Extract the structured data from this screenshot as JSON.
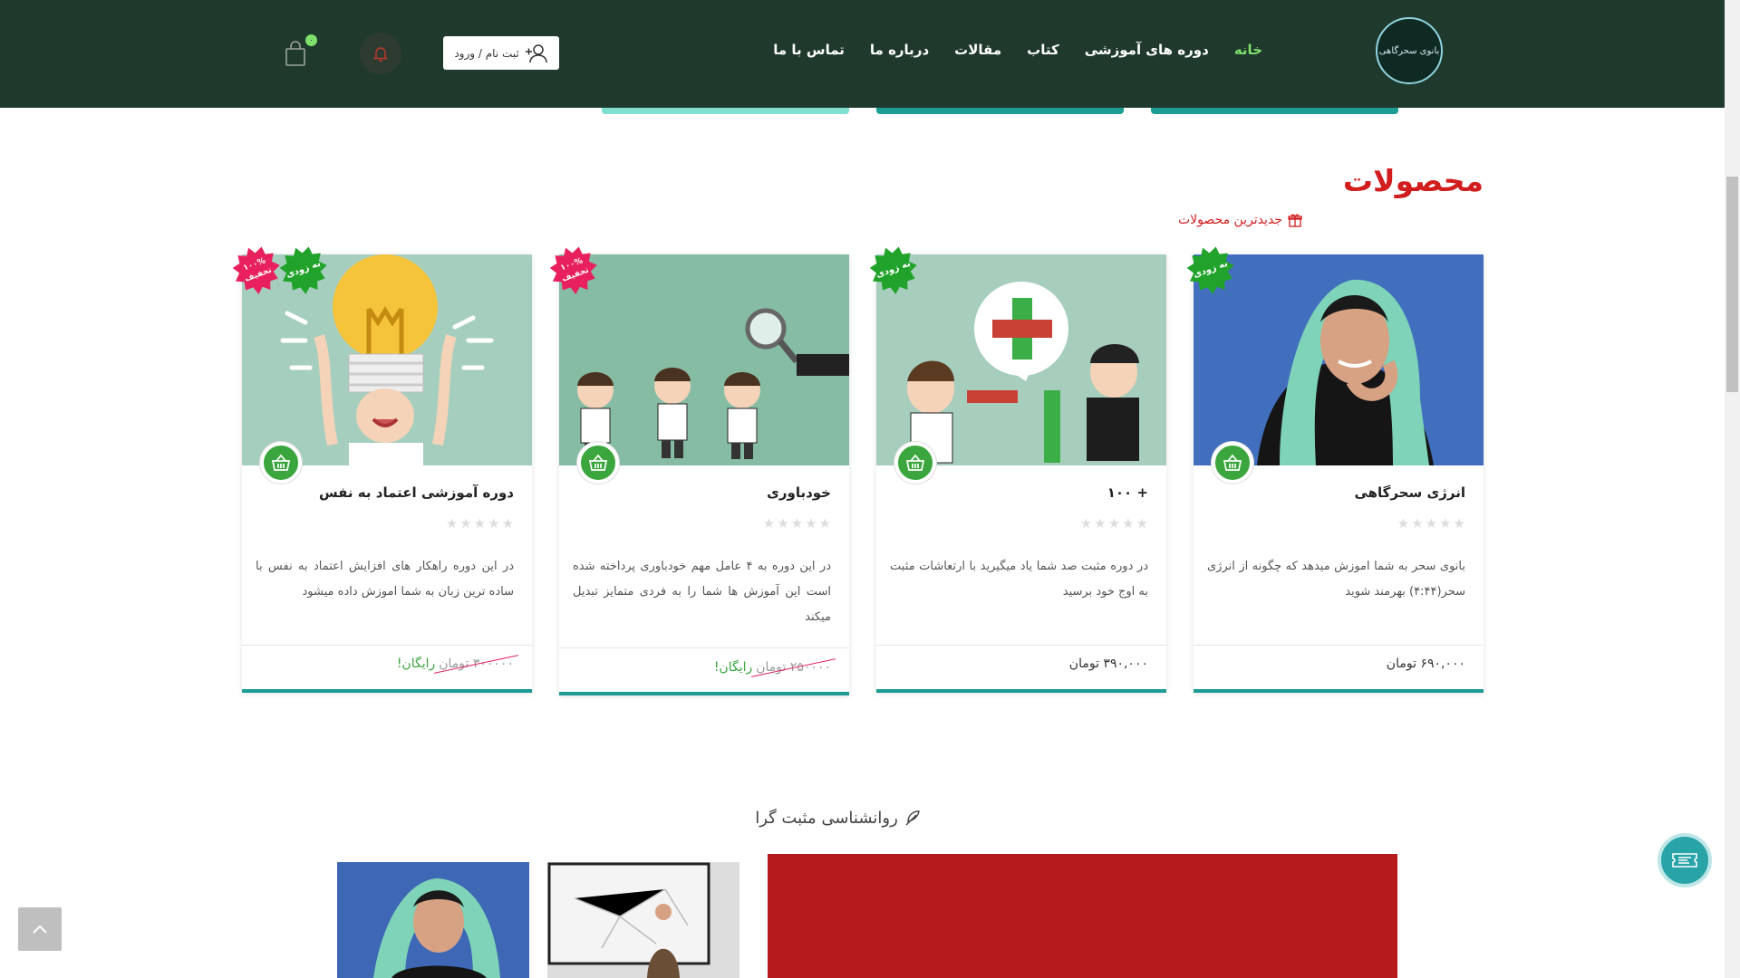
{
  "header": {
    "logo_text": "بانوی سحرگاهی",
    "nav": [
      {
        "label": "خانه",
        "active": true
      },
      {
        "label": "دوره های آموزشی",
        "active": false
      },
      {
        "label": "کتاب",
        "active": false
      },
      {
        "label": "مقالات",
        "active": false
      },
      {
        "label": "درباره ما",
        "active": false
      },
      {
        "label": "تماس با ما",
        "active": false
      }
    ],
    "login_label": "ثبت نام / ورود",
    "cart_count": "۰"
  },
  "products_section": {
    "title": "محصولات",
    "subtitle": "جدیدترین محصولات"
  },
  "products": [
    {
      "title": "انرژی سحرگاهی",
      "description": "بانوی سحر به شما اموزش میدهد که چگونه از انرژی سحر(۴:۴۴) بهرمند شوید",
      "price": "۶۹۰,۰۰۰ تومان",
      "old_price": "",
      "free_label": "",
      "new_badge": "به زودی",
      "discount_badge": ""
    },
    {
      "title": "+ ۱۰۰",
      "description": "در دوره مثبت صد شما یاد میگیرید با ارتعاشات مثبت به اوج خود برسید",
      "price": "۳۹۰,۰۰۰ تومان",
      "old_price": "",
      "free_label": "",
      "new_badge": "به زودی",
      "discount_badge": ""
    },
    {
      "title": "خودباوری",
      "description": "در این دوره به ۴ عامل مهم خودباوری پرداخته شده است این آموزش ها شما را به فردی متمایز تبدیل میکند",
      "price": "",
      "old_price": "۲۵۰۰۰۰ تومان",
      "free_label": "رایگان!",
      "new_badge": "",
      "discount_badge": "۱۰۰% تخفیف"
    },
    {
      "title": "دوره آموزشی اعتماد به نفس",
      "description": "در این دوره راهکار های افزایش اعتماد به نفس با ساده ترین زبان به شما اموزش داده میشود",
      "price": "",
      "old_price": "۳۰۰۰۰۰ تومان",
      "free_label": "رایگان!",
      "new_badge": "به زودی",
      "discount_badge": "۱۰۰% تخفیف"
    }
  ],
  "section2": {
    "title": "روانشناسی مثبت گرا"
  },
  "colors": {
    "header_bg": "#1f3a2c",
    "accent_green": "#3aa63d",
    "accent_red": "#d11d1d",
    "teal": "#1c9c94"
  }
}
